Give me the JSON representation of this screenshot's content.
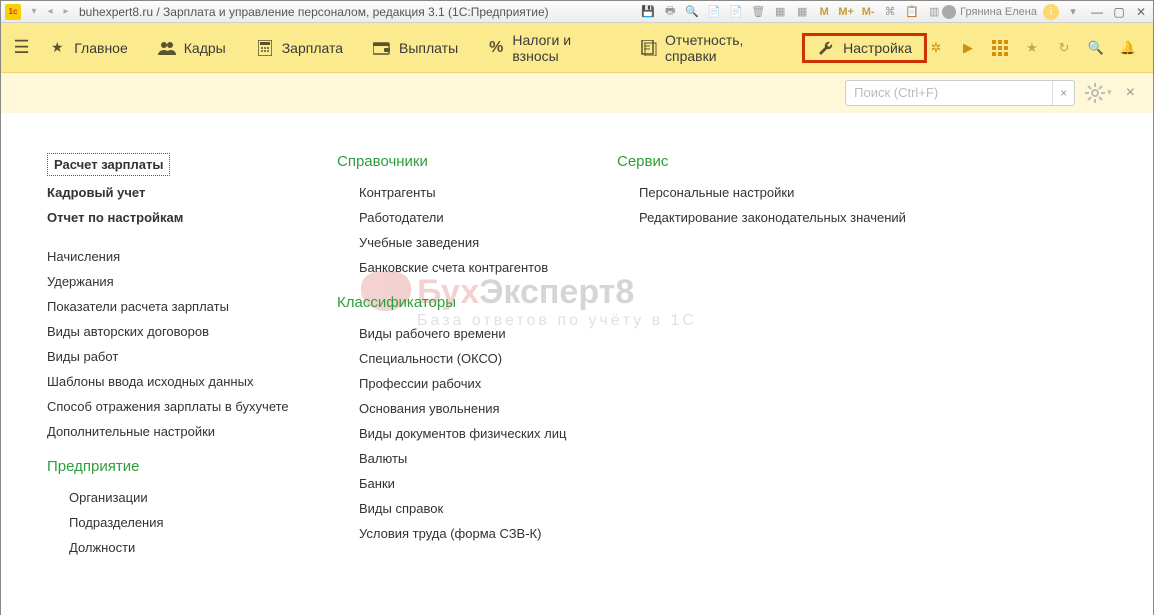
{
  "titlebar": {
    "title": "buhexpert8.ru / Зарплата и управление персоналом, редакция 3.1  (1С:Предприятие)",
    "m1": "M",
    "m2": "M+",
    "m3": "M-",
    "user": "Грянина Елена"
  },
  "nav": {
    "main": "Главное",
    "kadry": "Кадры",
    "zarplata": "Зарплата",
    "vyplaty": "Выплаты",
    "nalogi": "Налоги и взносы",
    "otchet": "Отчетность, справки",
    "nastroika": "Настройка"
  },
  "search": {
    "placeholder": "Поиск (Ctrl+F)"
  },
  "col1": {
    "raschet": "Расчет зарплаты",
    "kadrovyi": "Кадровый учет",
    "otchet": "Отчет по настройкам",
    "nachisleniya": "Начисления",
    "uderzhaniya": "Удержания",
    "pokazateli": "Показатели расчета зарплаты",
    "avtorskie": "Виды авторских договоров",
    "vidy_rabot": "Виды работ",
    "shablony": "Шаблоны ввода исходных данных",
    "sposob": "Способ отражения зарплаты в бухучете",
    "dop": "Дополнительные настройки",
    "predpr_head": "Предприятие",
    "org": "Организации",
    "podrazd": "Подразделения",
    "dolzh": "Должности"
  },
  "col2": {
    "sprav_head": "Справочники",
    "kontragenty": "Контрагенты",
    "rabotodateli": "Работодатели",
    "uchebnye": "Учебные заведения",
    "bank_scheta": "Банковские счета контрагентов",
    "klass_head": "Классификаторы",
    "vidy_rv": "Виды рабочего времени",
    "spec": "Специальности (ОКСО)",
    "prof": "Профессии рабочих",
    "osnov": "Основания увольнения",
    "vidy_dok": "Виды документов физических лиц",
    "valyuty": "Валюты",
    "banki": "Банки",
    "vidy_sprav": "Виды справок",
    "usloviya": "Условия труда (форма СЗВ-К)"
  },
  "col3": {
    "servis_head": "Сервис",
    "pers": "Персональные настройки",
    "redakt": "Редактирование законодательных значений"
  },
  "watermark": {
    "b": "Бух",
    "e": "Эксперт8",
    "sub": "База ответов по учёту в 1С"
  }
}
